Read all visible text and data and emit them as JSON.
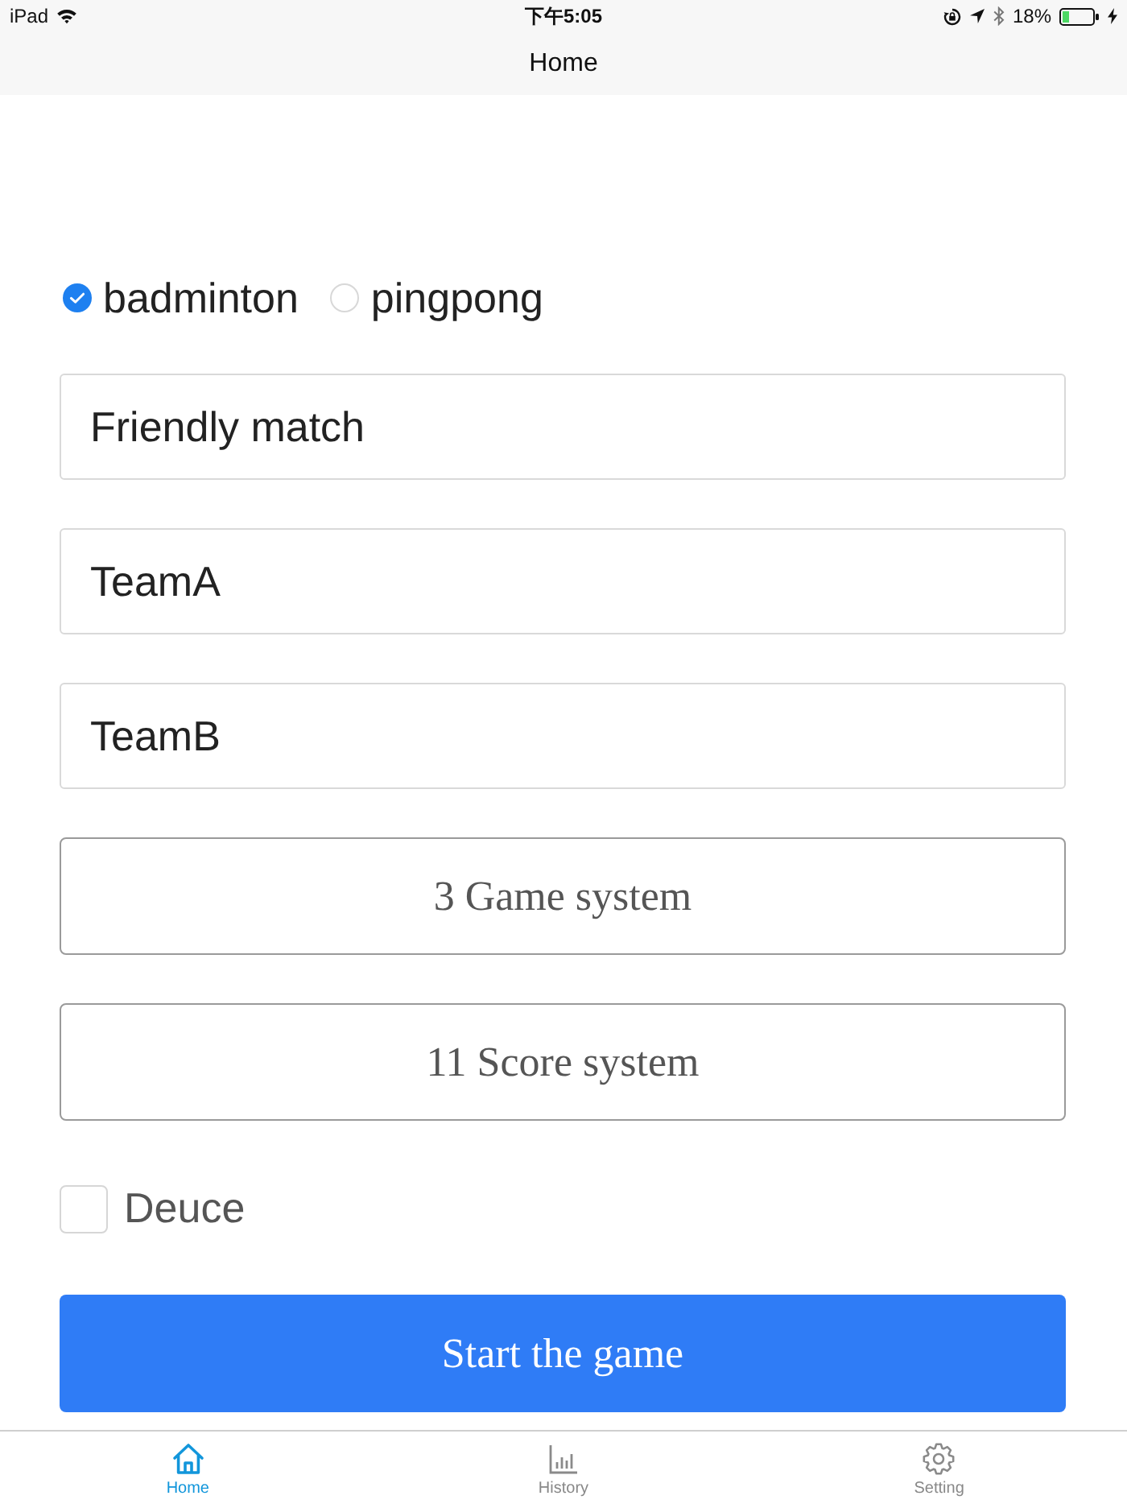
{
  "status_bar": {
    "device": "iPad",
    "time": "下午5:05",
    "battery": "18%"
  },
  "nav_bar": {
    "title": "Home"
  },
  "sport_options": [
    {
      "label": "badminton",
      "selected": true
    },
    {
      "label": "pingpong",
      "selected": false
    }
  ],
  "fields": [
    {
      "value": "Friendly match"
    },
    {
      "value": "TeamA"
    },
    {
      "value": "TeamB"
    }
  ],
  "pickers": [
    {
      "label": "3 Game system"
    },
    {
      "label": "11 Score system"
    }
  ],
  "deuce": {
    "label": "Deuce",
    "checked": false
  },
  "start_button": {
    "label": "Start the game"
  },
  "tab_bar": [
    {
      "kind": "home",
      "label": "Home",
      "selected": true
    },
    {
      "kind": "history",
      "label": "History",
      "selected": false
    },
    {
      "kind": "setting",
      "label": "Setting",
      "selected": false
    }
  ]
}
